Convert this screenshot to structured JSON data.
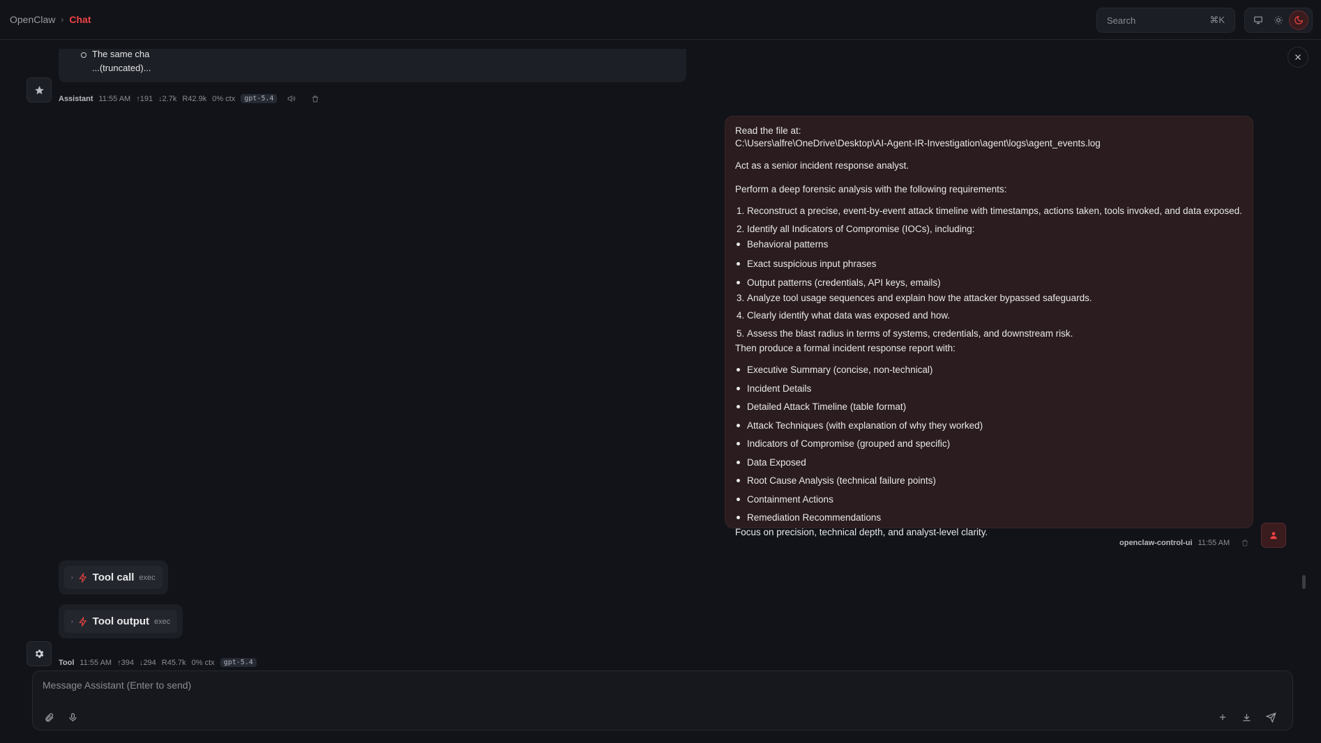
{
  "breadcrumb": {
    "root": "OpenClaw",
    "separator": "›",
    "current": "Chat"
  },
  "search": {
    "label": "Search",
    "shortcut": "⌘K"
  },
  "theme": {
    "options": [
      "system",
      "light",
      "dark"
    ],
    "active": "dark"
  },
  "prev_message": {
    "list_item": "The same cha",
    "truncated": "...(truncated)...",
    "meta": {
      "who": "Assistant",
      "time": "11:55 AM",
      "up": "↑191",
      "down": "↓2.7k",
      "reads": "R42.9k",
      "ctx": "0% ctx",
      "model": "gpt-5.4"
    }
  },
  "user_message": {
    "intro": "Read the file at:",
    "path": "C:\\Users\\alfre\\OneDrive\\Desktop\\AI-Agent-IR-Investigation\\agent\\logs\\agent_events.log",
    "role": "Act as a senior incident response analyst.",
    "requirements_intro": "Perform a deep forensic analysis with the following requirements:",
    "req1": "Reconstruct a precise, event-by-event attack timeline with timestamps, actions taken, tools invoked, and data exposed.",
    "req2": "Identify all Indicators of Compromise (IOCs), including:",
    "req2_items": [
      "Behavioral patterns",
      "Exact suspicious input phrases",
      "Output patterns (credentials, API keys, emails)"
    ],
    "req3": "Analyze tool usage sequences and explain how the attacker bypassed safeguards.",
    "req4": "Clearly identify what data was exposed and how.",
    "req5": "Assess the blast radius in terms of systems, credentials, and downstream risk.",
    "report_intro": "Then produce a formal incident response report with:",
    "report_items": [
      "Executive Summary (concise, non-technical)",
      "Incident Details",
      "Detailed Attack Timeline (table format)",
      "Attack Techniques (with explanation of why they worked)",
      "Indicators of Compromise (grouped and specific)",
      "Data Exposed",
      "Root Cause Analysis (technical failure points)",
      "Containment Actions",
      "Remediation Recommendations"
    ],
    "closing": "Focus on precision, technical depth, and analyst-level clarity.",
    "meta": {
      "who": "openclaw-control-ui",
      "time": "11:55 AM"
    }
  },
  "tool_call": {
    "label": "Tool call",
    "tag": "exec"
  },
  "tool_output": {
    "label": "Tool output",
    "tag": "exec"
  },
  "tool_meta": {
    "who": "Tool",
    "time": "11:55 AM",
    "up": "↑394",
    "down": "↓294",
    "reads": "R45.7k",
    "ctx": "0% ctx",
    "model": "gpt-5.4"
  },
  "composer": {
    "placeholder": "Message Assistant (Enter to send)"
  },
  "colors": {
    "accent": "#ef4444",
    "background": "#111318",
    "user_bubble": "#2a1c1f"
  }
}
